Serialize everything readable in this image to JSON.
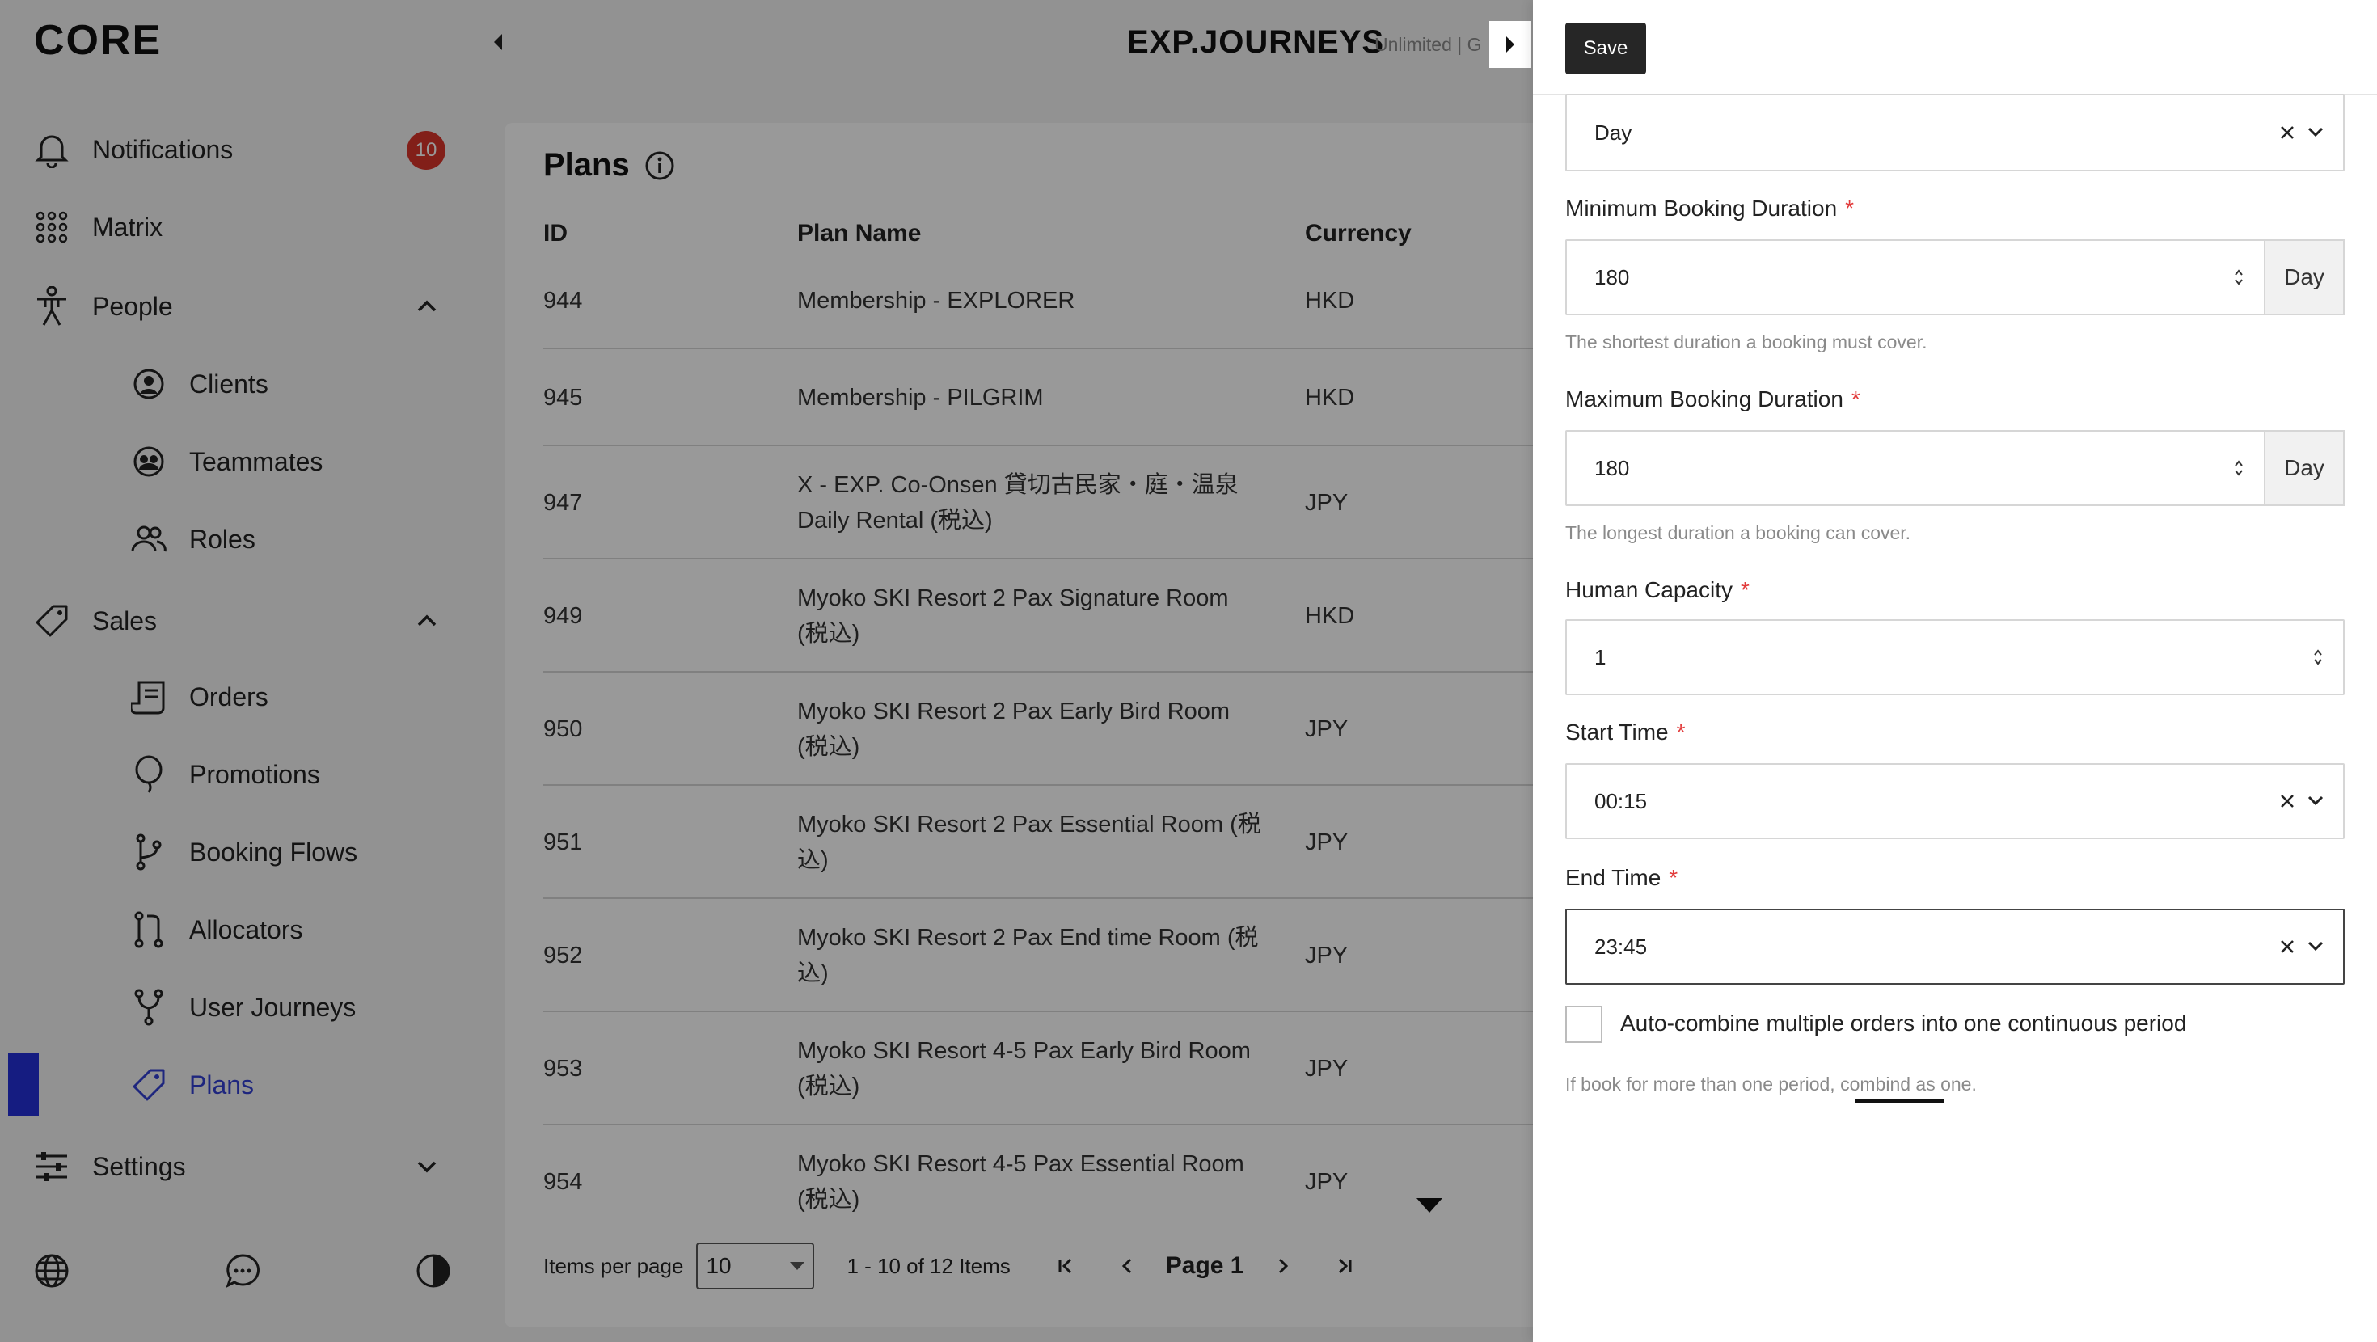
{
  "brand": {
    "logo": "CORE",
    "app_title": "EXP.JOURNEYS",
    "app_subtitle": "Unlimited | G"
  },
  "sidebar": {
    "notifications": {
      "label": "Notifications",
      "badge": "10"
    },
    "matrix": {
      "label": "Matrix"
    },
    "people": {
      "label": "People",
      "items": [
        {
          "label": "Clients"
        },
        {
          "label": "Teammates"
        },
        {
          "label": "Roles"
        }
      ]
    },
    "sales": {
      "label": "Sales",
      "items": [
        {
          "label": "Orders"
        },
        {
          "label": "Promotions"
        },
        {
          "label": "Booking Flows"
        },
        {
          "label": "Allocators"
        },
        {
          "label": "User Journeys"
        },
        {
          "label": "Plans"
        }
      ]
    },
    "settings": {
      "label": "Settings"
    },
    "active_item": "Plans"
  },
  "plans": {
    "title": "Plans",
    "columns": [
      "ID",
      "Plan Name",
      "Currency"
    ],
    "rows": [
      {
        "id": "944",
        "name": [
          "Membership - EXPLORER"
        ],
        "currency": "HKD"
      },
      {
        "id": "945",
        "name": [
          "Membership - PILGRIM"
        ],
        "currency": "HKD"
      },
      {
        "id": "947",
        "name": [
          "X - EXP. Co-Onsen 貸切古民家・庭・温泉",
          "Daily Rental (税込)"
        ],
        "currency": "JPY"
      },
      {
        "id": "949",
        "name": [
          "Myoko SKI Resort 2 Pax Signature Room",
          "(税込)"
        ],
        "currency": "HKD"
      },
      {
        "id": "950",
        "name": [
          "Myoko SKI Resort 2 Pax Early Bird Room",
          "(税込)"
        ],
        "currency": "JPY"
      },
      {
        "id": "951",
        "name": [
          "Myoko SKI Resort 2 Pax Essential Room (税",
          "込)"
        ],
        "currency": "JPY"
      },
      {
        "id": "952",
        "name": [
          "Myoko SKI Resort 2 Pax End time Room (税",
          "込)"
        ],
        "currency": "JPY"
      },
      {
        "id": "953",
        "name": [
          "Myoko SKI Resort 4-5 Pax Early Bird Room",
          "(税込)"
        ],
        "currency": "JPY"
      },
      {
        "id": "954",
        "name": [
          "Myoko SKI Resort 4-5 Pax Essential Room",
          "(税込)"
        ],
        "currency": "JPY"
      }
    ],
    "pagination": {
      "items_per_page_label": "Items per page",
      "items_per_page": "10",
      "range": "1 - 10 of 12 Items",
      "page_label": "Page 1"
    }
  },
  "drawer": {
    "save_label": "Save",
    "unit_select": {
      "value": "Day"
    },
    "min_duration": {
      "label": "Minimum Booking Duration",
      "required": "*",
      "value": "180",
      "unit": "Day",
      "helper": "The shortest duration a booking must cover."
    },
    "max_duration": {
      "label": "Maximum Booking Duration",
      "required": "*",
      "value": "180",
      "unit": "Day",
      "helper": "The longest duration a booking can cover."
    },
    "capacity": {
      "label": "Human Capacity",
      "required": "*",
      "value": "1"
    },
    "start_time": {
      "label": "Start Time",
      "required": "*",
      "value": "00:15"
    },
    "end_time": {
      "label": "End Time",
      "required": "*",
      "value": "23:45"
    },
    "auto_combine": {
      "label": "Auto-combine multiple orders into one continuous period",
      "helper": "If book for more than one period, combind as one.",
      "checked": false
    }
  },
  "colors": {
    "accent": "#2430d8",
    "badge": "#d9342b",
    "required": "#e23b3b",
    "save": "#262626"
  }
}
